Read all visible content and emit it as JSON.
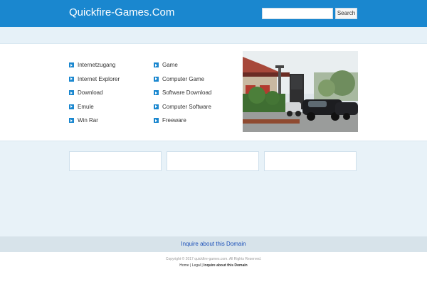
{
  "header": {
    "brand": "Quickfire-Games.Com",
    "search_button": "Search",
    "search_placeholder": ""
  },
  "links": {
    "column1": [
      "Internetzugang",
      "Internet Explorer",
      "Download",
      "Emule",
      "Win Rar"
    ],
    "column2": [
      "Game",
      "Computer Game",
      "Software Download",
      "Computer Software",
      "Freeware"
    ]
  },
  "inquire": {
    "label": "Inquire about this Domain"
  },
  "footer": {
    "copyright": "Copyright © 2017 quickfire-games.com. All Rights Reserved.",
    "home": "Home",
    "separator": " | ",
    "legal": "Legal",
    "inquire": "Inquire about this Domain"
  },
  "colors": {
    "header_bg": "#1a87cf",
    "link_blue": "#1a4fb8"
  }
}
